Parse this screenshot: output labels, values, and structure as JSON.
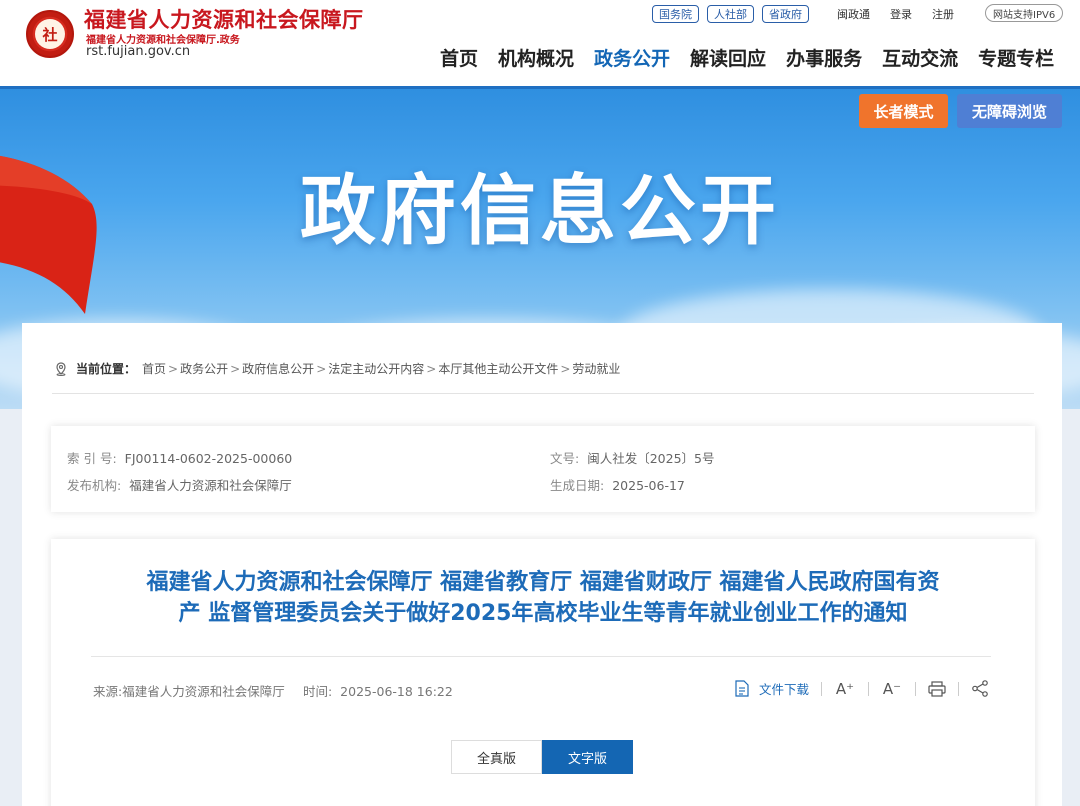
{
  "header": {
    "emblem_text": "社",
    "site_title": "福建省人力资源和社会保障厅",
    "site_subtitle": "福建省人力资源和社会保障厅.政务",
    "site_domain": "rst.fujian.gov.cn",
    "top_pills": [
      "国务院",
      "人社部",
      "省政府"
    ],
    "top_links": [
      "闽政通",
      "登录",
      "注册"
    ],
    "ipv6_label": "网站支持IPV6",
    "nav": [
      "首页",
      "机构概况",
      "政务公开",
      "解读回应",
      "办事服务",
      "互动交流",
      "专题专栏"
    ],
    "active_nav": "政务公开"
  },
  "banner": {
    "title": "政府信息公开",
    "elder_mode_label": "长者模式",
    "accessible_label": "无障碍浏览"
  },
  "breadcrumb": {
    "lead": "当前位置：",
    "items": [
      "首页",
      "政务公开",
      "政府信息公开",
      "法定主动公开内容",
      "本厅其他主动公开文件",
      "劳动就业"
    ],
    "separator": ">"
  },
  "meta": {
    "index_label": "索 引 号:",
    "index_value": "FJ00114-0602-2025-00060",
    "issuer_label": "发布机构:",
    "issuer_value": "福建省人力资源和社会保障厅",
    "docno_label": "文号:",
    "docno_value": "闽人社发〔2025〕5号",
    "date_label": "生成日期:",
    "date_value": "2025-06-17"
  },
  "document": {
    "title_line1": "福建省人力资源和社会保障厅 福建省教育厅 福建省财政厅 福建省人民政府国有资",
    "title_line2": "产 监督管理委员会关于做好2025年高校毕业生等青年就业创业工作的通知",
    "source": "来源:福建省人力资源和社会保障厅",
    "time_label": "时间:",
    "time_value": "2025-06-18 16:22",
    "download_label": "文件下载",
    "font_larger": "A⁺",
    "font_smaller": "A⁻",
    "version_tabs": [
      "全真版",
      "文字版"
    ],
    "active_version": "文字版"
  }
}
